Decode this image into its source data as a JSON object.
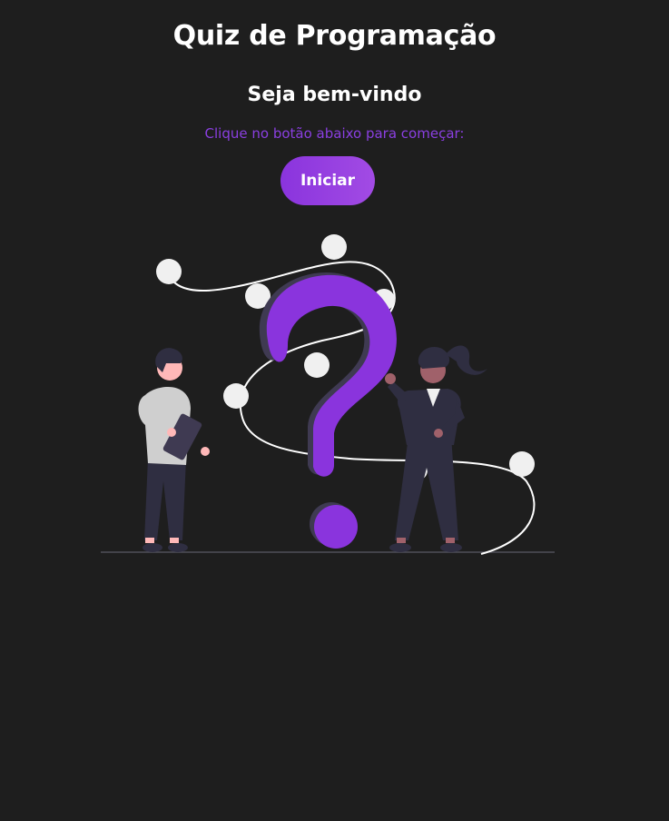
{
  "header": {
    "title": "Quiz de Programação"
  },
  "start_screen": {
    "heading": "Seja bem-vindo",
    "instruction": "Clique no botão abaixo para começar:",
    "start_button_label": "Iniciar"
  },
  "colors": {
    "background": "#1e1e1e",
    "accent": "#8a3fe0",
    "text": "#ffffff"
  },
  "illustration": {
    "icon": "question-mark-people-illustration"
  }
}
